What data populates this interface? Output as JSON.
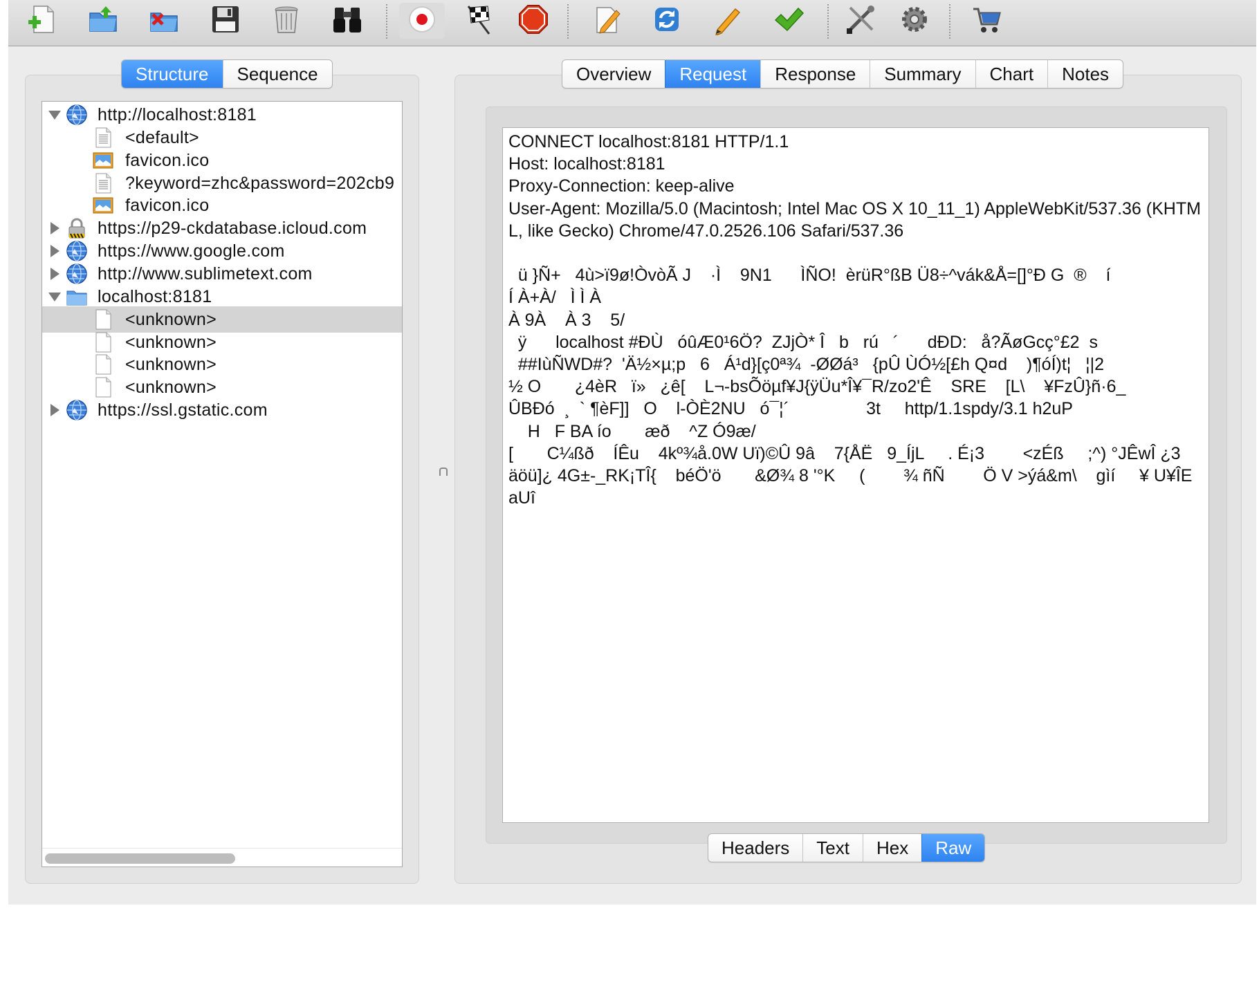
{
  "toolbar": {
    "buttons": [
      {
        "id": "new-session",
        "icon": "new-document-icon"
      },
      {
        "id": "open-session",
        "icon": "open-folder-icon"
      },
      {
        "id": "close-session",
        "icon": "close-folder-icon"
      },
      {
        "id": "save-session",
        "icon": "floppy-disk-icon"
      },
      {
        "id": "clear",
        "icon": "trash-can-icon"
      },
      {
        "id": "find",
        "icon": "binoculars-icon"
      },
      {
        "id": "record",
        "icon": "record-icon"
      },
      {
        "id": "throttle",
        "icon": "checkered-flag-icon"
      },
      {
        "id": "breakpoints",
        "icon": "stop-sign-icon"
      },
      {
        "id": "edit",
        "icon": "edit-document-icon"
      },
      {
        "id": "repeat",
        "icon": "refresh-icon"
      },
      {
        "id": "pencil",
        "icon": "pencil-icon"
      },
      {
        "id": "validate",
        "icon": "checkmark-icon"
      },
      {
        "id": "tools",
        "icon": "tools-icon"
      },
      {
        "id": "settings",
        "icon": "gear-icon"
      },
      {
        "id": "shop",
        "icon": "shopping-cart-icon"
      }
    ]
  },
  "left": {
    "tabs": [
      "Structure",
      "Sequence"
    ],
    "active_tab": "Structure",
    "tree": [
      {
        "label": "http://localhost:8181",
        "level": 0,
        "expanded": true,
        "icon": "globe-icon"
      },
      {
        "label": "<default>",
        "level": 1,
        "icon": "text-document-icon"
      },
      {
        "label": "favicon.ico",
        "level": 1,
        "icon": "image-icon"
      },
      {
        "label": "?keyword=zhc&password=202cb9",
        "level": 1,
        "icon": "text-document-icon"
      },
      {
        "label": "favicon.ico",
        "level": 1,
        "icon": "image-icon"
      },
      {
        "label": "https://p29-ckdatabase.icloud.com",
        "level": 0,
        "expanded": false,
        "icon": "lock-icon"
      },
      {
        "label": "https://www.google.com",
        "level": 0,
        "expanded": false,
        "icon": "globe-icon"
      },
      {
        "label": "http://www.sublimetext.com",
        "level": 0,
        "expanded": false,
        "icon": "globe-icon"
      },
      {
        "label": "localhost:8181",
        "level": 0,
        "expanded": true,
        "icon": "folder-icon"
      },
      {
        "label": "<unknown>",
        "level": 1,
        "icon": "blank-document-icon",
        "selected": true
      },
      {
        "label": "<unknown>",
        "level": 1,
        "icon": "blank-document-icon"
      },
      {
        "label": "<unknown>",
        "level": 1,
        "icon": "blank-document-icon"
      },
      {
        "label": "<unknown>",
        "level": 1,
        "icon": "blank-document-icon"
      },
      {
        "label": "https://ssl.gstatic.com",
        "level": 0,
        "expanded": false,
        "icon": "globe-icon"
      }
    ]
  },
  "right": {
    "tabs": [
      "Overview",
      "Request",
      "Response",
      "Summary",
      "Chart",
      "Notes"
    ],
    "active_tab": "Request",
    "view_tabs": [
      "Headers",
      "Text",
      "Hex",
      "Raw"
    ],
    "active_view_tab": "Raw",
    "raw_text": "CONNECT localhost:8181 HTTP/1.1\nHost: localhost:8181\nProxy-Connection: keep-alive\nUser-Agent: Mozilla/5.0 (Macintosh; Intel Mac OS X 10_11_1) AppleWebKit/537.36 (KHTML, like Gecko) Chrome/47.0.2526.106 Safari/537.36\n\n  ü }Ñ+   4ù>ï9ø!ÒvòÃ J    ·Ì    9N1      ÌÑO!  èrüR°ßB Ü8÷^vák&Å=[]°Ð G  ®    í\nÍ À+À/   Ì Ì À\nÀ 9À    À 3    5/\n  ÿ      localhost #ÐÙ   óûÆ0¹6Ö?  ZJjÒ* Î   b   rú   ´      dÐD:   å?ÃøGcç°£2  s\n  ##IùÑWD#?  'Ä½×µ;p   6   Á¹d}[ç0ª¾  -ØØá³   {pÛ ÙÓ½[£h Q¤d    )¶óÍ)t¦   ¦|2\n½ O       ¿4èR   ï»   ¿ê[    L¬-bsÕöµf¥J{ÿÜu*Î¥¯R/zo2'Ê    SRE    [L\\    ¥FzÛ}ñ·6_\nÛBÐó  ¸  ` ¶èF]]   O    l-ÒÈ2NU   ó¯¦´                3t     http/1.1spdy/3.1 h2uP\n    H   F BA ío       æð    ^Z Ó9æ/\n[       C¼ßð    ÍÊu    4kº¾å.0W Uï)©Û 9â    7{ÅË   9_ÍjL     . É¡3        <zÉß     ;^) °JÊwÎ ¿3\näöü]¿ 4G±-_RK¡TÎ{    béÖ'ö       &Ø¾ 8 '°K     (        ¾ ñÑ        Ö V >ýá&m\\    gìí     ¥ U¥ÎE\naUî"
  }
}
